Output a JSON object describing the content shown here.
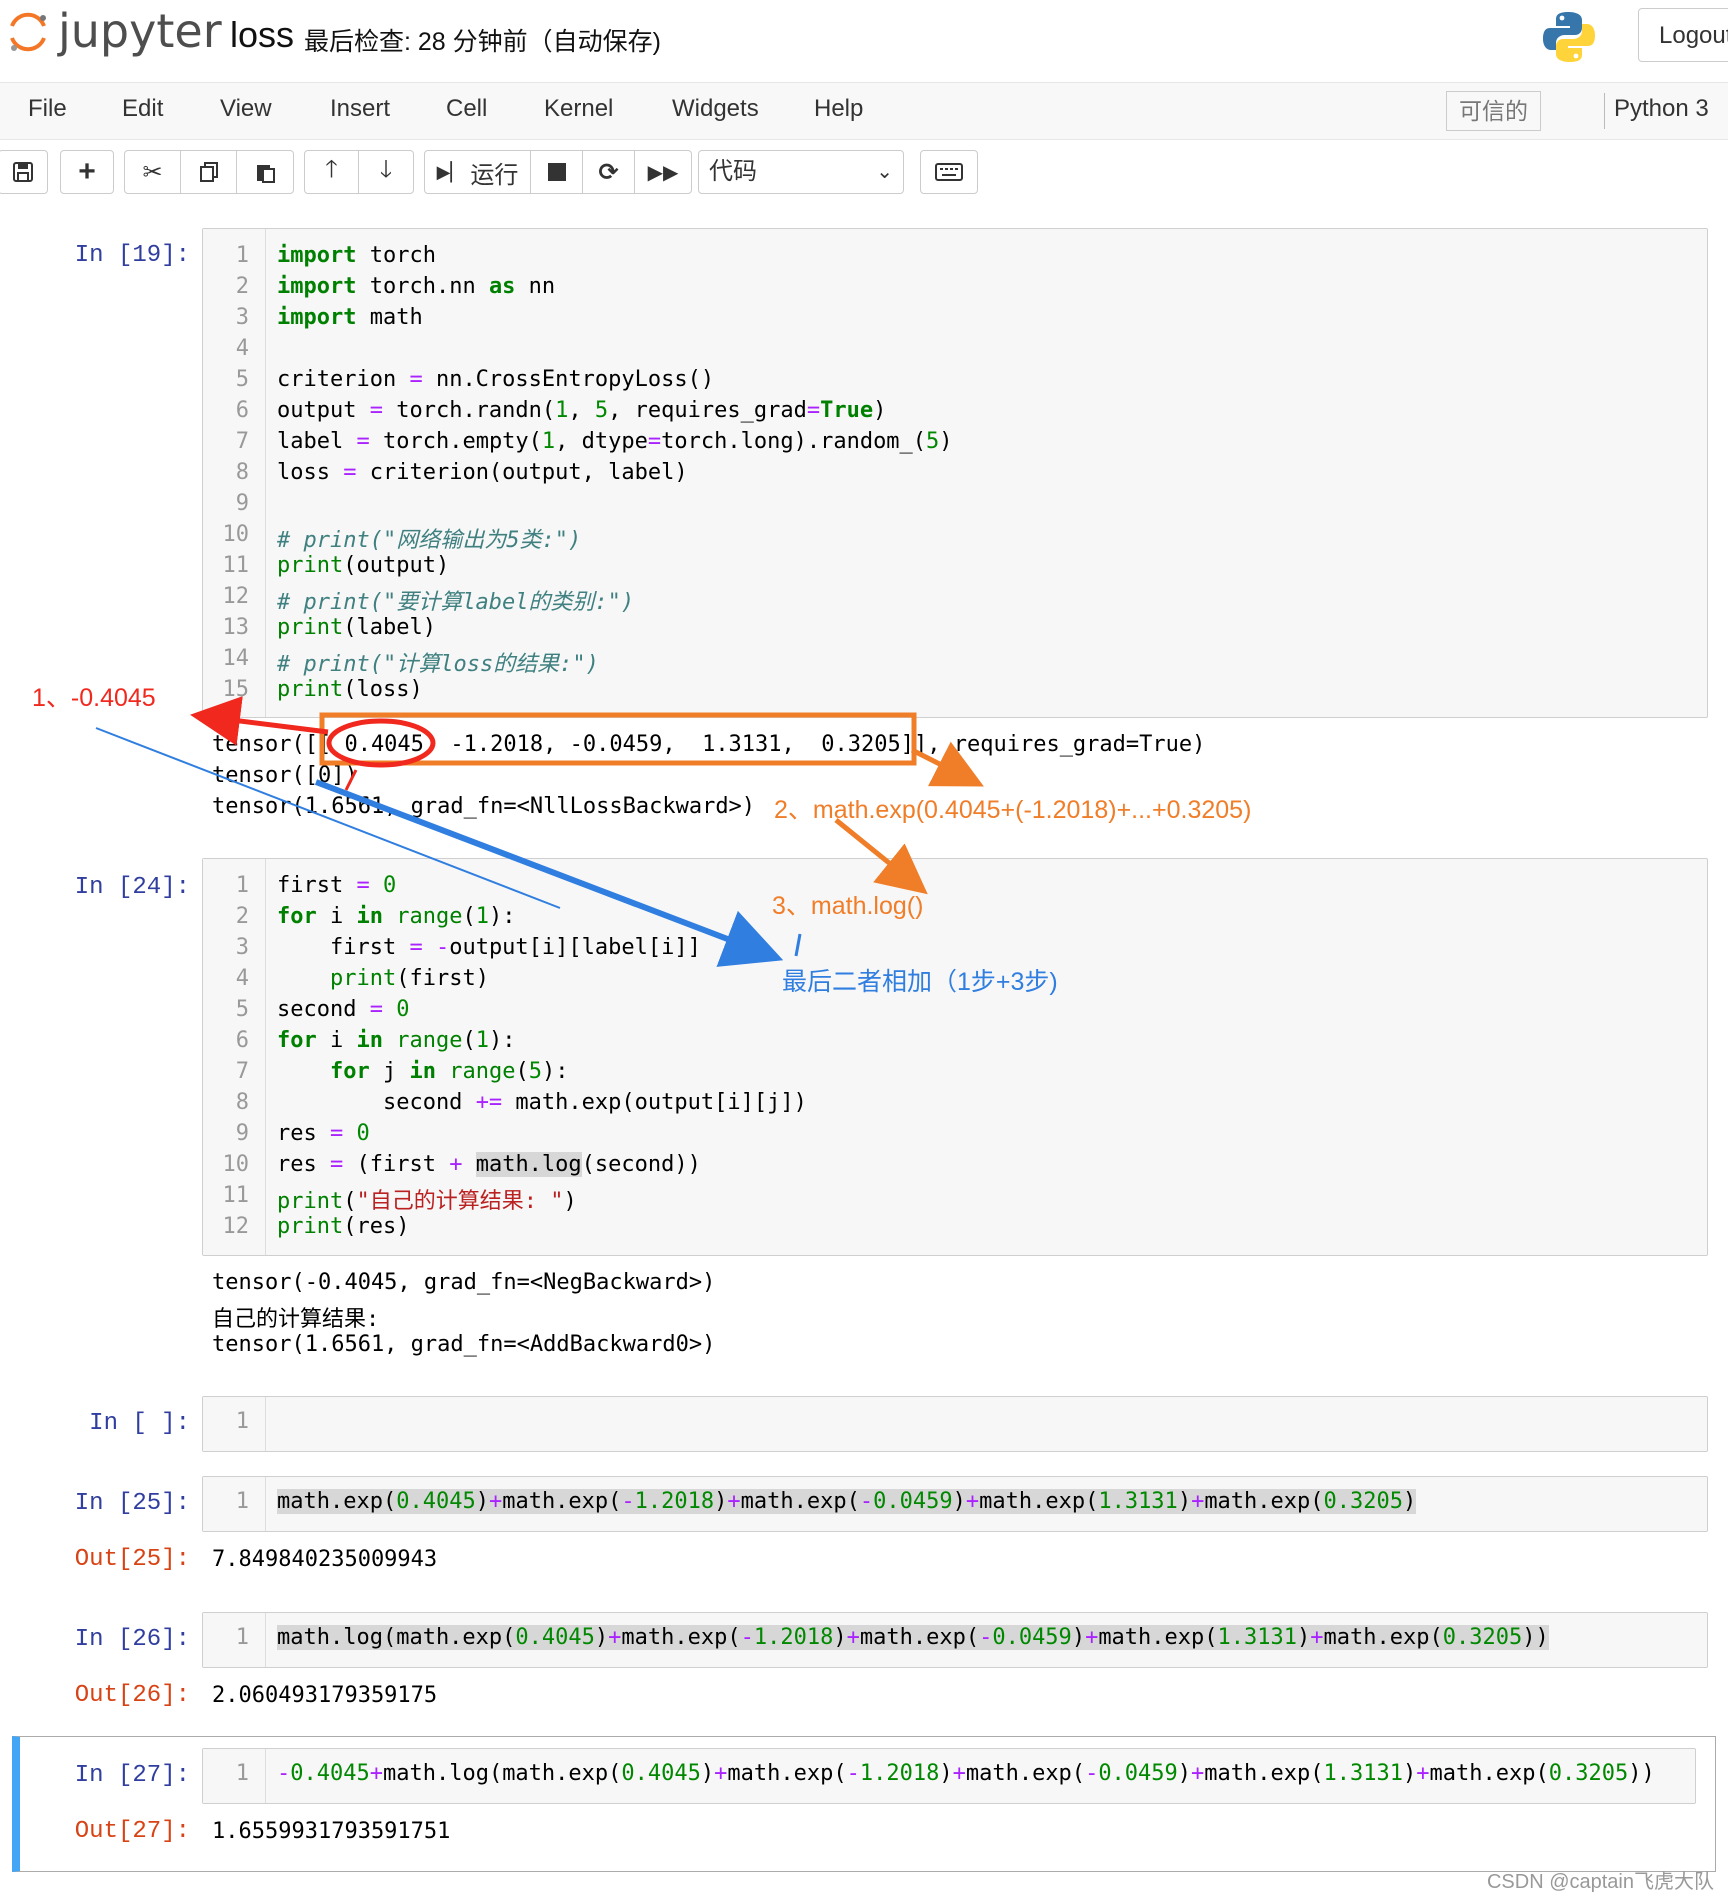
{
  "header": {
    "logo_text": "jupyter",
    "notebook_name": "loss",
    "checkpoint": "最后检查: 28 分钟前（自动保存)",
    "logout_label": "Logout"
  },
  "menu": {
    "items": [
      "File",
      "Edit",
      "View",
      "Insert",
      "Cell",
      "Kernel",
      "Widgets",
      "Help"
    ],
    "trusted": "可信的",
    "kernel": "Python 3"
  },
  "toolbar": {
    "run_label": "运行",
    "cell_type": "代码"
  },
  "cells": [
    {
      "prompt": "In [19]:",
      "lines": [
        "import torch",
        "import torch.nn as nn",
        "import math",
        "",
        "criterion = nn.CrossEntropyLoss()",
        "output = torch.randn(1, 5, requires_grad=True)",
        "label = torch.empty(1, dtype=torch.long).random_(5)",
        "loss = criterion(output, label)",
        "",
        "# print(\"网络输出为5类:\")",
        "print(output)",
        "# print(\"要计算label的类别:\")",
        "print(label)",
        "# print(\"计算loss的结果:\")",
        "print(loss)"
      ],
      "output": [
        "tensor([[ 0.4045, -1.2018, -0.0459,  1.3131,  0.3205]], requires_grad=True)",
        "tensor([0])",
        "tensor(1.6561, grad_fn=<NllLossBackward>)"
      ]
    },
    {
      "prompt": "In [24]:",
      "lines": [
        "first = 0",
        "for i in range(1):",
        "    first = -output[i][label[i]]",
        "    print(first)",
        "second = 0",
        "for i in range(1):",
        "    for j in range(5):",
        "        second += math.exp(output[i][j])",
        "res = 0",
        "res = (first + math.log(second))",
        "print(\"自己的计算结果: \")",
        "print(res)"
      ],
      "output": [
        "tensor(-0.4045, grad_fn=<NegBackward>)",
        "自己的计算结果:",
        "tensor(1.6561, grad_fn=<AddBackward0>)"
      ]
    },
    {
      "prompt": "In [ ]:",
      "lines": [
        ""
      ]
    },
    {
      "prompt": "In [25]:",
      "lines": [
        "math.exp(0.4045)+math.exp(-1.2018)+math.exp(-0.0459)+math.exp(1.3131)+math.exp(0.3205)"
      ],
      "out_prompt": "Out[25]:",
      "output": [
        "7.849840235009943"
      ]
    },
    {
      "prompt": "In [26]:",
      "lines": [
        "math.log(math.exp(0.4045)+math.exp(-1.2018)+math.exp(-0.0459)+math.exp(1.3131)+math.exp(0.3205))"
      ],
      "out_prompt": "Out[26]:",
      "output": [
        "2.060493179359175"
      ]
    },
    {
      "prompt": "In [27]:",
      "lines": [
        "-0.4045+math.log(math.exp(0.4045)+math.exp(-1.2018)+math.exp(-0.0459)+math.exp(1.3131)+math.exp(0.3205))"
      ],
      "out_prompt": "Out[27]:",
      "output": [
        "1.6559931793591751"
      ]
    }
  ],
  "annotations": {
    "a1": "1、-0.4045",
    "a2": "2、math.exp(0.4045+(-1.2018)+...+0.3205)",
    "a3": "3、math.log()",
    "a4": "最后二者相加（1步+3步)"
  },
  "colors": {
    "red": "#f0281e",
    "orange": "#f07d28",
    "blue": "#2f7ee0",
    "selected_cell_bar": "#42a5f5"
  },
  "watermark": "CSDN @captain飞虎大队"
}
